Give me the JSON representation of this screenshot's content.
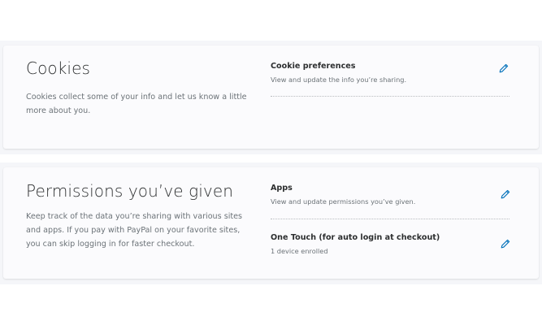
{
  "cookies": {
    "title": "Cookies",
    "description": "Cookies collect some of your info and let us know a little more about you.",
    "items": [
      {
        "title": "Cookie preferences",
        "subtitle": "View and update the info you’re sharing.",
        "action_icon": "pencil-icon"
      }
    ]
  },
  "permissions": {
    "title": "Permissions you’ve given",
    "description": "Keep track of the data you’re sharing with various sites and apps. If you pay with PayPal on your favorite sites, you can skip logging in for faster checkout.",
    "items": [
      {
        "title": "Apps",
        "subtitle": "View and update permissions you’ve given.",
        "action_icon": "pencil-icon"
      },
      {
        "title": "One Touch (for auto login at checkout)",
        "subtitle": "1 device enrolled",
        "action_icon": "pencil-icon"
      }
    ]
  },
  "colors": {
    "accent": "#0070ba",
    "heading": "#2c2e2f",
    "body_text": "#6c7378",
    "card_background": "#fbfbfd",
    "band_background": "#f5f6f9"
  }
}
